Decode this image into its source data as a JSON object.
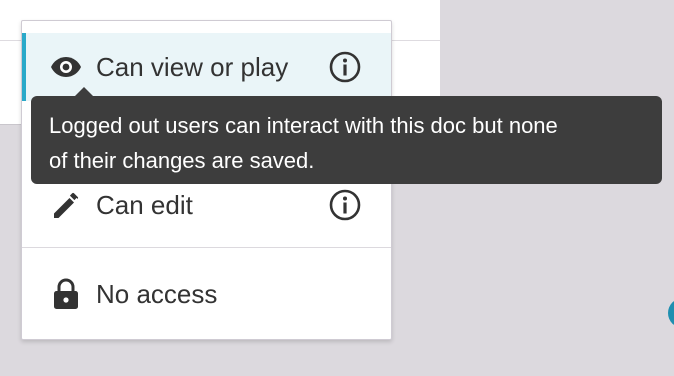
{
  "menu": {
    "items": [
      {
        "label": "Can view or play",
        "icon": "eye-icon",
        "selected": true,
        "has_info": true
      },
      {
        "label": "Can edit",
        "icon": "pencil-icon",
        "selected": false,
        "has_info": true
      },
      {
        "label": "No access",
        "icon": "lock-icon",
        "selected": false,
        "has_info": false
      }
    ]
  },
  "tooltip": {
    "line1": "Logged out users can interact with this doc but none",
    "line2": "of their changes are saved."
  },
  "colors": {
    "accent": "#29a9c9",
    "tooltip_bg": "#3d3d3d",
    "selected_bg": "#eaf5f8"
  }
}
